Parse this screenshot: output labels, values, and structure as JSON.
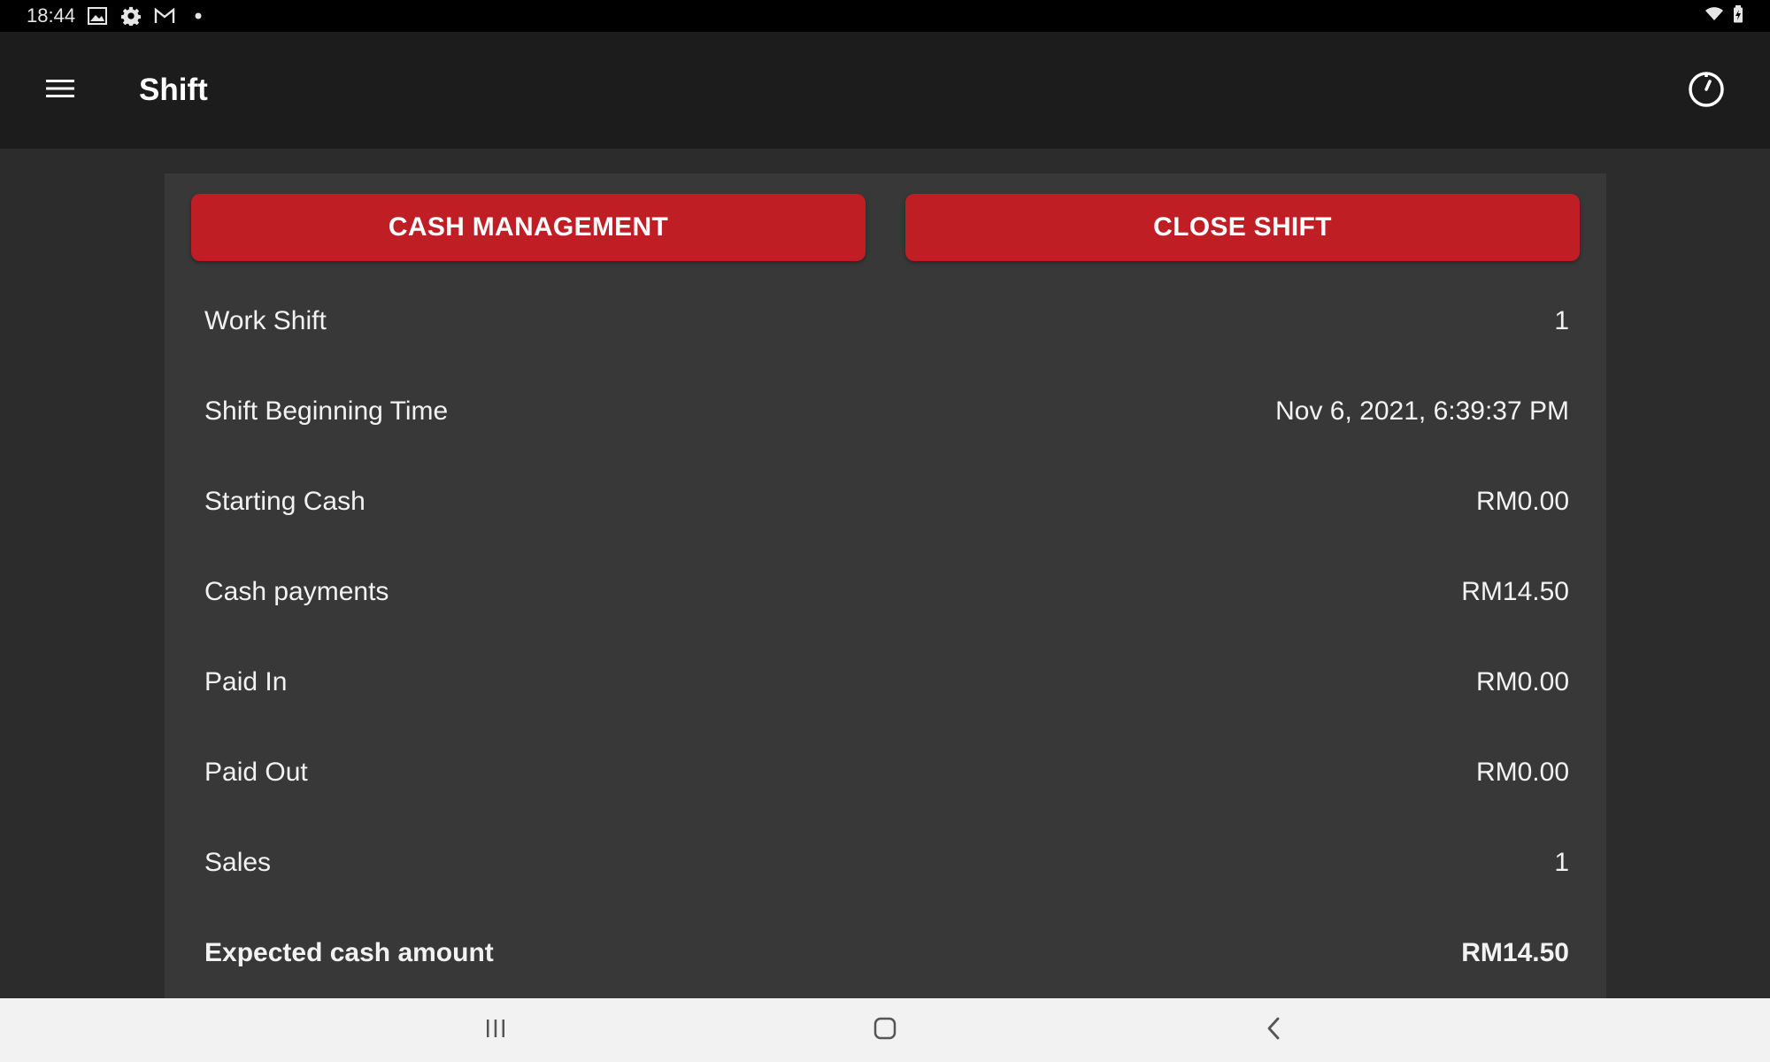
{
  "status_bar": {
    "time": "18:44",
    "icons": [
      "image-icon",
      "settings-gear-icon",
      "gmail-icon",
      "notification-dot-icon"
    ],
    "right_icons": [
      "wifi-icon",
      "battery-icon"
    ]
  },
  "app_bar": {
    "title": "Shift",
    "menu_icon": "hamburger-menu-icon",
    "action_icon": "timer-icon"
  },
  "actions": {
    "cash_management_label": "CASH MANAGEMENT",
    "close_shift_label": "CLOSE SHIFT"
  },
  "shift_details": [
    {
      "label": "Work Shift",
      "value": "1"
    },
    {
      "label": "Shift Beginning Time",
      "value": "Nov 6, 2021, 6:39:37 PM"
    },
    {
      "label": "Starting Cash",
      "value": "RM0.00"
    },
    {
      "label": "Cash payments",
      "value": "RM14.50"
    },
    {
      "label": "Paid In",
      "value": "RM0.00"
    },
    {
      "label": "Paid Out",
      "value": "RM0.00"
    },
    {
      "label": "Sales",
      "value": "1"
    },
    {
      "label": "Expected cash amount",
      "value": "RM14.50"
    }
  ],
  "nav_bar": {
    "icons": [
      "recent-apps-icon",
      "home-icon",
      "back-icon"
    ]
  },
  "colors": {
    "accent": "#be1e24",
    "app_bar": "#1c1c1c",
    "panel": "#383838",
    "background": "#2c2c2c"
  }
}
